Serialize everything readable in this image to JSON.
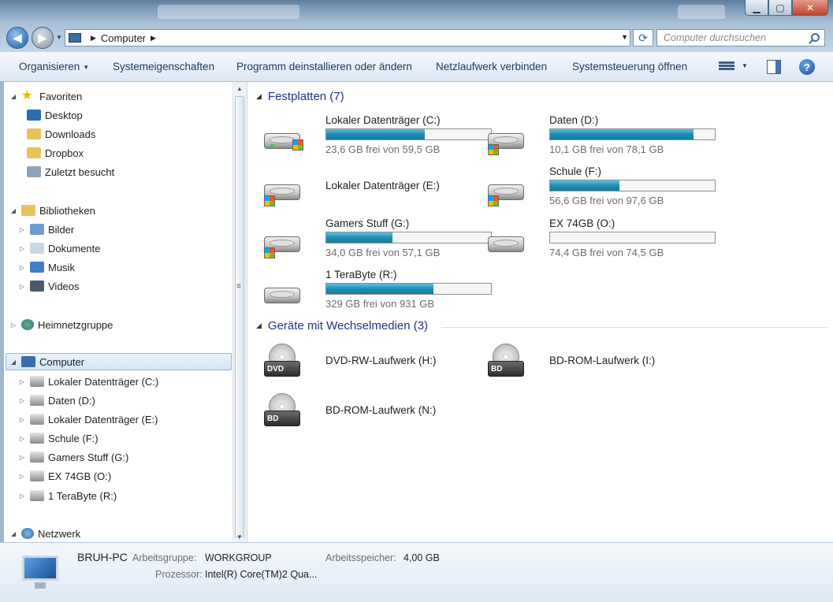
{
  "address": {
    "path": "Computer",
    "search_placeholder": "Computer durchsuchen"
  },
  "toolbar": {
    "organize": "Organisieren",
    "system_properties": "Systemeigenschaften",
    "uninstall": "Programm deinstallieren oder ändern",
    "map_drive": "Netzlaufwerk verbinden",
    "control_panel": "Systemsteuerung öffnen"
  },
  "sidebar": {
    "favorites": {
      "label": "Favoriten",
      "items": [
        "Desktop",
        "Downloads",
        "Dropbox",
        "Zuletzt besucht"
      ]
    },
    "libraries": {
      "label": "Bibliotheken",
      "items": [
        "Bilder",
        "Dokumente",
        "Musik",
        "Videos"
      ]
    },
    "homegroup": "Heimnetzgruppe",
    "computer": {
      "label": "Computer",
      "items": [
        "Lokaler Datenträger (C:)",
        "Daten (D:)",
        "Lokaler Datenträger (E:)",
        "Schule  (F:)",
        "Gamers Stuff (G:)",
        "EX 74GB (O:)",
        "1 TeraByte (R:)"
      ]
    },
    "network": "Netzwerk"
  },
  "hard_disks": {
    "header": "Festplatten (7)",
    "drives": [
      {
        "name": "Lokaler Datenträger (C:)",
        "free": "23,6 GB frei von 59,5 GB",
        "used_fraction": 0.6,
        "icon": "hdd-windows-icon"
      },
      {
        "name": "Daten (D:)",
        "free": "10,1 GB frei von 78,1 GB",
        "used_fraction": 0.87,
        "icon": "hdd-icon"
      },
      {
        "name": "Lokaler Datenträger (E:)",
        "free": "",
        "used_fraction": null,
        "icon": "hdd-icon"
      },
      {
        "name": "Schule  (F:)",
        "free": "56,6 GB frei von 97,6 GB",
        "used_fraction": 0.42,
        "icon": "hdd-icon"
      },
      {
        "name": "Gamers Stuff (G:)",
        "free": "34,0 GB frei von 57,1 GB",
        "used_fraction": 0.4,
        "icon": "hdd-icon"
      },
      {
        "name": "EX 74GB (O:)",
        "free": "74,4 GB frei von 74,5 GB",
        "used_fraction": 0.001,
        "icon": "hdd-icon"
      },
      {
        "name": "1 TeraByte (R:)",
        "free": "329 GB frei von 931 GB",
        "used_fraction": 0.65,
        "icon": "hdd-icon"
      }
    ]
  },
  "removable": {
    "header": "Geräte mit Wechselmedien (3)",
    "devices": [
      {
        "name": "DVD-RW-Laufwerk (H:)",
        "badge": "DVD",
        "icon": "dvd-drive-icon"
      },
      {
        "name": "BD-ROM-Laufwerk (I:)",
        "badge": "BD",
        "icon": "bd-drive-icon"
      },
      {
        "name": "BD-ROM-Laufwerk (N:)",
        "badge": "BD",
        "icon": "bd-drive-icon"
      }
    ]
  },
  "details": {
    "name": "BRUH-PC",
    "workgroup_label": "Arbeitsgruppe:",
    "workgroup_value": "WORKGROUP",
    "memory_label": "Arbeitsspeicher:",
    "memory_value": "4,00 GB",
    "cpu_label": "Prozessor:",
    "cpu_value": "Intel(R) Core(TM)2 Qua..."
  },
  "colors": {
    "bar_fill": "#1f8db2",
    "header_text": "#1e3287",
    "toolbar_text": "#1e395b"
  }
}
